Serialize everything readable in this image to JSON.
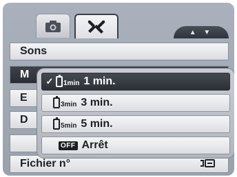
{
  "tabs": [
    {
      "name": "camera",
      "icon": "camera-icon"
    },
    {
      "name": "setup",
      "icon": "wrench-screwdriver-icon",
      "active": true
    }
  ],
  "scroll_indicator": "▲ ▼",
  "menu": {
    "rows": [
      {
        "label": "Sons",
        "value": ""
      },
      {
        "label": "M",
        "value": ""
      },
      {
        "label": "E",
        "value": ""
      },
      {
        "label": "D",
        "value": ""
      },
      {
        "label": "",
        "value": ""
      },
      {
        "label": "Fichier n°",
        "value": ""
      }
    ]
  },
  "popup": {
    "options": [
      {
        "label": "1 min.",
        "sub": "1min",
        "icon": "battery-icon",
        "selected": true,
        "check": "✓"
      },
      {
        "label": "3 min.",
        "sub": "3min",
        "icon": "battery-icon",
        "selected": false
      },
      {
        "label": "5 min.",
        "sub": "5min",
        "icon": "battery-icon",
        "selected": false
      },
      {
        "label": "Arrêt",
        "badge": "OFF",
        "icon": "off-icon",
        "selected": false
      }
    ]
  }
}
